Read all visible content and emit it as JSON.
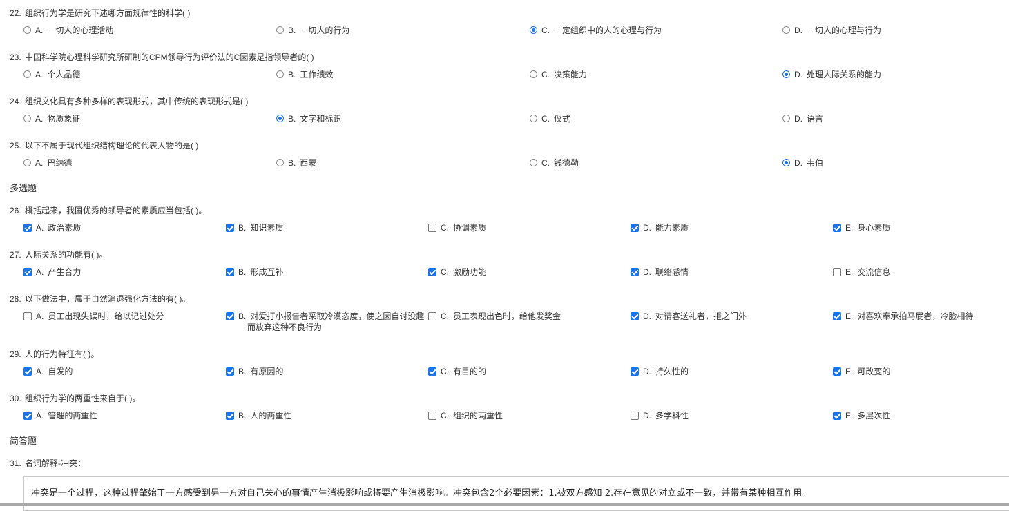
{
  "single_choice": [
    {
      "num": "22.",
      "text": "组织行为学是研究下述哪方面规律性的科学( )",
      "options": [
        {
          "letter": "A.",
          "text": "一切人的心理活动",
          "selected": false
        },
        {
          "letter": "B.",
          "text": "一切人的行为",
          "selected": false
        },
        {
          "letter": "C.",
          "text": "一定组织中的人的心理与行为",
          "selected": true
        },
        {
          "letter": "D.",
          "text": "一切人的心理与行为",
          "selected": false
        }
      ]
    },
    {
      "num": "23.",
      "text": "中国科学院心理科学研究所研制的CPM领导行为评价法的C因素是指领导者的( )",
      "options": [
        {
          "letter": "A.",
          "text": "个人品德",
          "selected": false
        },
        {
          "letter": "B.",
          "text": "工作绩效",
          "selected": false
        },
        {
          "letter": "C.",
          "text": "决策能力",
          "selected": false
        },
        {
          "letter": "D.",
          "text": "处理人际关系的能力",
          "selected": true
        }
      ]
    },
    {
      "num": "24.",
      "text": "组织文化具有多种多样的表现形式，其中传统的表现形式是( )",
      "options": [
        {
          "letter": "A.",
          "text": "物质象征",
          "selected": false
        },
        {
          "letter": "B.",
          "text": "文字和标识",
          "selected": true
        },
        {
          "letter": "C.",
          "text": "仪式",
          "selected": false
        },
        {
          "letter": "D.",
          "text": "语言",
          "selected": false
        }
      ]
    },
    {
      "num": "25.",
      "text": "以下不属于现代组织结构理论的代表人物的是( )",
      "options": [
        {
          "letter": "A.",
          "text": "巴纳德",
          "selected": false
        },
        {
          "letter": "B.",
          "text": "西蒙",
          "selected": false
        },
        {
          "letter": "C.",
          "text": "钱德勒",
          "selected": false
        },
        {
          "letter": "D.",
          "text": "韦伯",
          "selected": true
        }
      ]
    }
  ],
  "multi_section_label": "多选题",
  "multi_choice": [
    {
      "num": "26.",
      "text": "概括起来，我国优秀的领导者的素质应当包括( )。",
      "options": [
        {
          "letter": "A.",
          "text": "政治素质",
          "checked": true
        },
        {
          "letter": "B.",
          "text": "知识素质",
          "checked": true
        },
        {
          "letter": "C.",
          "text": "协调素质",
          "checked": false
        },
        {
          "letter": "D.",
          "text": "能力素质",
          "checked": true
        },
        {
          "letter": "E.",
          "text": "身心素质",
          "checked": true
        }
      ]
    },
    {
      "num": "27.",
      "text": "人际关系的功能有( )。",
      "options": [
        {
          "letter": "A.",
          "text": "产生合力",
          "checked": true
        },
        {
          "letter": "B.",
          "text": "形成互补",
          "checked": true
        },
        {
          "letter": "C.",
          "text": "激励功能",
          "checked": true
        },
        {
          "letter": "D.",
          "text": "联络感情",
          "checked": true
        },
        {
          "letter": "E.",
          "text": "交流信息",
          "checked": false
        }
      ]
    },
    {
      "num": "28.",
      "text": "以下做法中，属于自然消退强化方法的有( )。",
      "options": [
        {
          "letter": "A.",
          "text": "员工出现失误时，给以记过处分",
          "checked": false
        },
        {
          "letter": "B.",
          "text": "对爱打小报告者采取冷漠态度，使之因自讨没趣",
          "text2": "而放弃这种不良行为",
          "checked": true
        },
        {
          "letter": "C.",
          "text": "员工表现出色时，给他发奖金",
          "checked": false
        },
        {
          "letter": "D.",
          "text": "对请客送礼者，拒之门外",
          "checked": true
        },
        {
          "letter": "E.",
          "text": "对喜欢奉承拍马屁者，冷脸相待",
          "checked": true
        }
      ]
    },
    {
      "num": "29.",
      "text": "人的行为特征有( )。",
      "options": [
        {
          "letter": "A.",
          "text": "自发的",
          "checked": true
        },
        {
          "letter": "B.",
          "text": "有原因的",
          "checked": true
        },
        {
          "letter": "C.",
          "text": "有目的的",
          "checked": true
        },
        {
          "letter": "D.",
          "text": "持久性的",
          "checked": true
        },
        {
          "letter": "E.",
          "text": "可改变的",
          "checked": true
        }
      ]
    },
    {
      "num": "30.",
      "text": "组织行为学的两重性来自于( )。",
      "options": [
        {
          "letter": "A.",
          "text": "管理的两重性",
          "checked": true
        },
        {
          "letter": "B.",
          "text": "人的两重性",
          "checked": true
        },
        {
          "letter": "C.",
          "text": "组织的两重性",
          "checked": false
        },
        {
          "letter": "D.",
          "text": "多学科性",
          "checked": false
        },
        {
          "letter": "E.",
          "text": "多层次性",
          "checked": true
        }
      ]
    }
  ],
  "short_section_label": "简答题",
  "short_answer": {
    "num": "31.",
    "text": "名词解释-冲突：",
    "answer": "冲突是一个过程，这种过程肇始于一方感受到另一方对自己关心的事情产生消极影响或将要产生消极影响。冲突包含2个必要因素：1.被双方感知 2.存在意见的对立或不一致，并带有某种相互作用。"
  },
  "colors": {
    "accent": "#1a73e8",
    "text": "#333333",
    "border": "#c8c8c8"
  }
}
